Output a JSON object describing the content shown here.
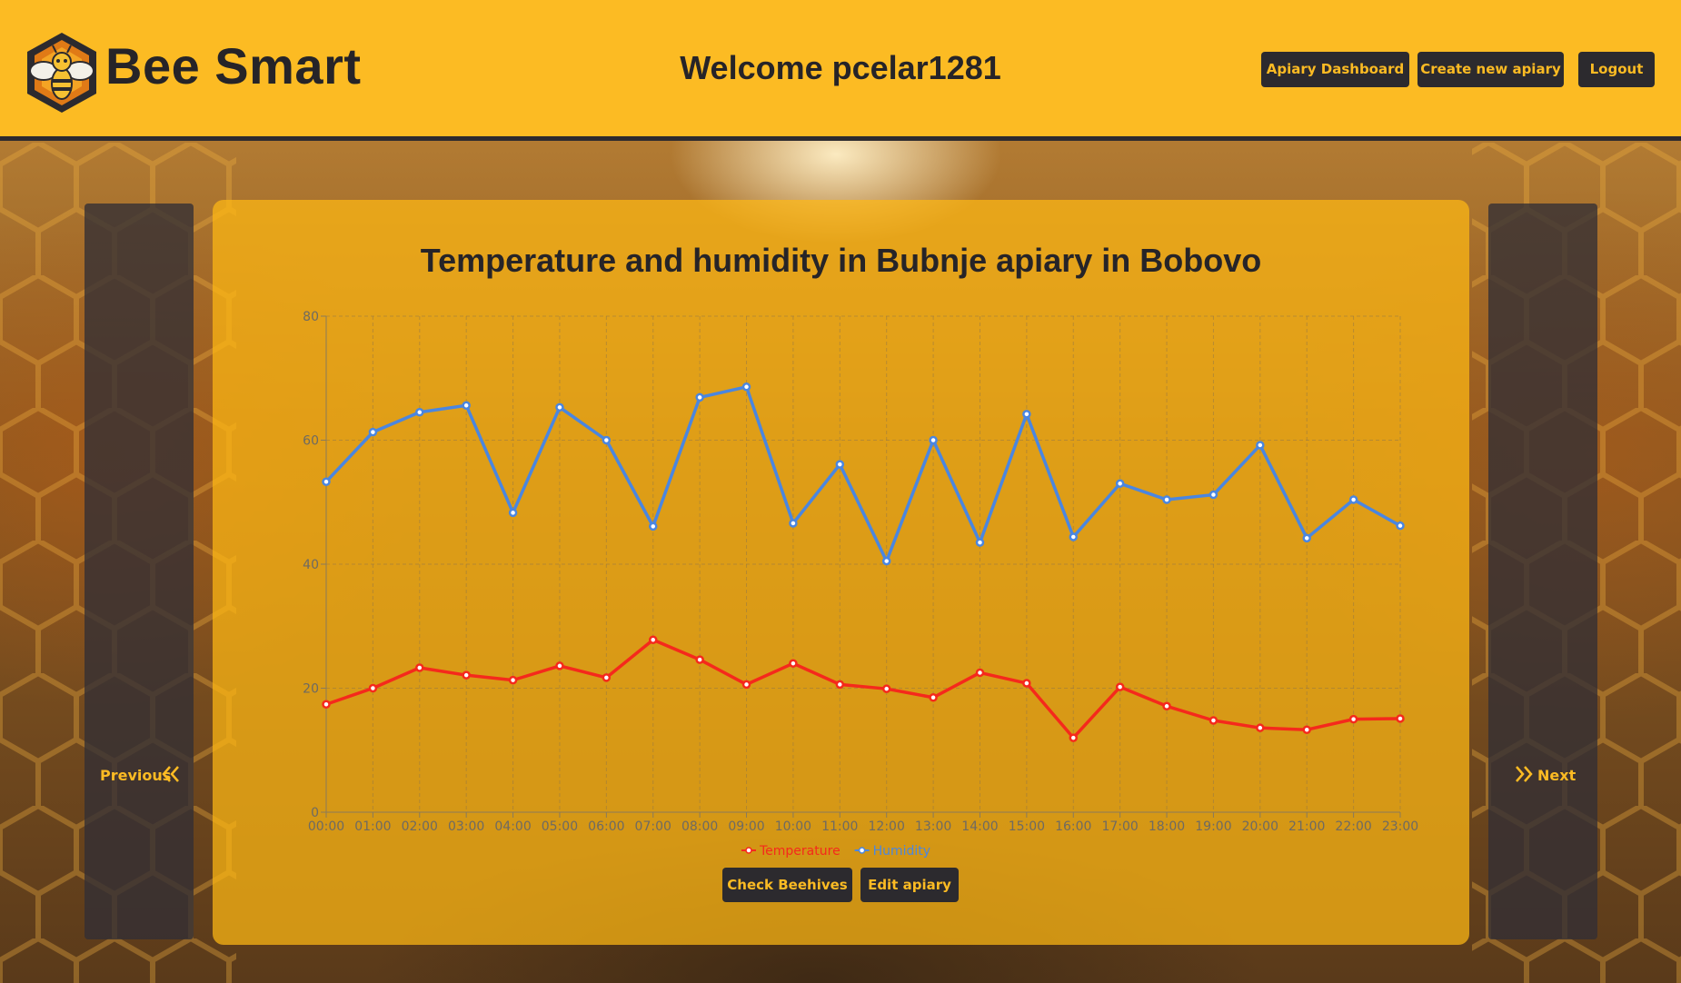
{
  "app": {
    "brand": "Bee Smart",
    "welcome": "Welcome pcelar1281"
  },
  "nav": {
    "dashboard": "Apiary Dashboard",
    "create": "Create new apiary",
    "logout": "Logout"
  },
  "carousel": {
    "previous": "Previous",
    "next": "Next"
  },
  "actions": {
    "check_beehives": "Check Beehives",
    "edit_apiary": "Edit apiary"
  },
  "colors": {
    "accent": "#fcbb23",
    "dark": "#2c2a2e",
    "temperature": "#f5291c",
    "humidity": "#4a86e0"
  },
  "chart_data": {
    "type": "line",
    "title": "Temperature and humidity in Bubnje apiary in Bobovo",
    "categories": [
      "00:00",
      "01:00",
      "02:00",
      "03:00",
      "04:00",
      "05:00",
      "06:00",
      "07:00",
      "08:00",
      "09:00",
      "10:00",
      "11:00",
      "12:00",
      "13:00",
      "14:00",
      "15:00",
      "16:00",
      "17:00",
      "18:00",
      "19:00",
      "20:00",
      "21:00",
      "22:00",
      "23:00"
    ],
    "ylim": [
      0,
      80
    ],
    "yticks": [
      0,
      20,
      40,
      60,
      80
    ],
    "grid": true,
    "legend_position": "bottom",
    "series": [
      {
        "name": "Temperature",
        "values": [
          17.4,
          20.0,
          23.3,
          22.1,
          21.3,
          23.6,
          21.7,
          27.8,
          24.6,
          20.6,
          24.0,
          20.6,
          19.9,
          18.5,
          22.5,
          20.8,
          12.0,
          20.2,
          17.1,
          14.8,
          13.6,
          13.3,
          15.0,
          15.1
        ]
      },
      {
        "name": "Humidity",
        "values": [
          53.3,
          61.3,
          64.5,
          65.6,
          48.3,
          65.3,
          60.0,
          46.1,
          66.9,
          68.6,
          46.6,
          56.1,
          40.5,
          60.0,
          43.5,
          64.2,
          44.4,
          53.0,
          50.4,
          51.2,
          59.2,
          44.2,
          50.4,
          46.2
        ]
      }
    ]
  }
}
